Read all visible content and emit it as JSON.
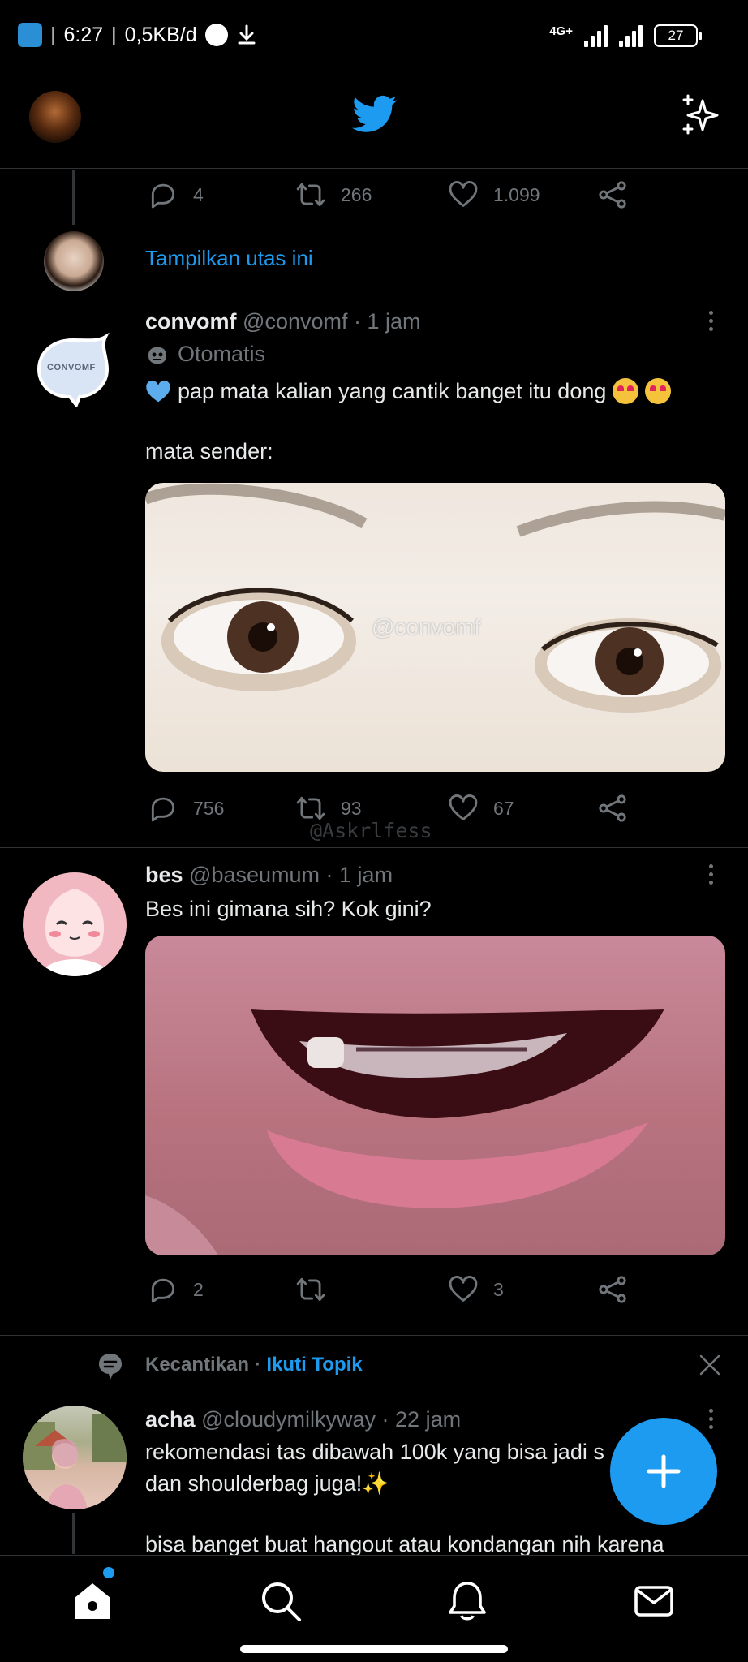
{
  "status_bar": {
    "time": "6:27",
    "speed": "0,5KB/d",
    "network": "4G+",
    "battery": "27"
  },
  "prev_tweet": {
    "reply_count": "4",
    "retweet_count": "266",
    "like_count": "1.099",
    "show_thread": "Tampilkan utas ini"
  },
  "tweet1": {
    "name": "convomf",
    "handle": "@convomf",
    "time": "· 1 jam",
    "automated_label": "Otomatis",
    "avatar_text": "CONVOMF",
    "line1": "pap mata kalian yang cantik banget itu dong",
    "line2": "mata sender:",
    "image_watermark": "@convomf",
    "reply_count": "756",
    "retweet_count": "93",
    "like_count": "67",
    "overlay_watermark": "@Askrlfess"
  },
  "tweet2": {
    "name": "bes",
    "handle": "@baseumum",
    "time": "· 1 jam",
    "text": "Bes ini gimana sih? Kok gini?",
    "reply_count": "2",
    "retweet_count": "",
    "like_count": "3"
  },
  "topic": {
    "name": "Kecantikan",
    "separator": "·",
    "follow": "Ikuti Topik"
  },
  "tweet3": {
    "name": "acha",
    "handle": "@cloudymilkyway",
    "time": "· 22 jam",
    "line1": "rekomendasi tas dibawah 100k yang bisa jadi s",
    "line2": "dan shoulderbag juga!✨",
    "line3": "bisa banget buat hangout atau kondangan nih karena"
  },
  "colors": {
    "accent": "#1d9bf0",
    "background": "#000000",
    "muted": "#71767b"
  }
}
